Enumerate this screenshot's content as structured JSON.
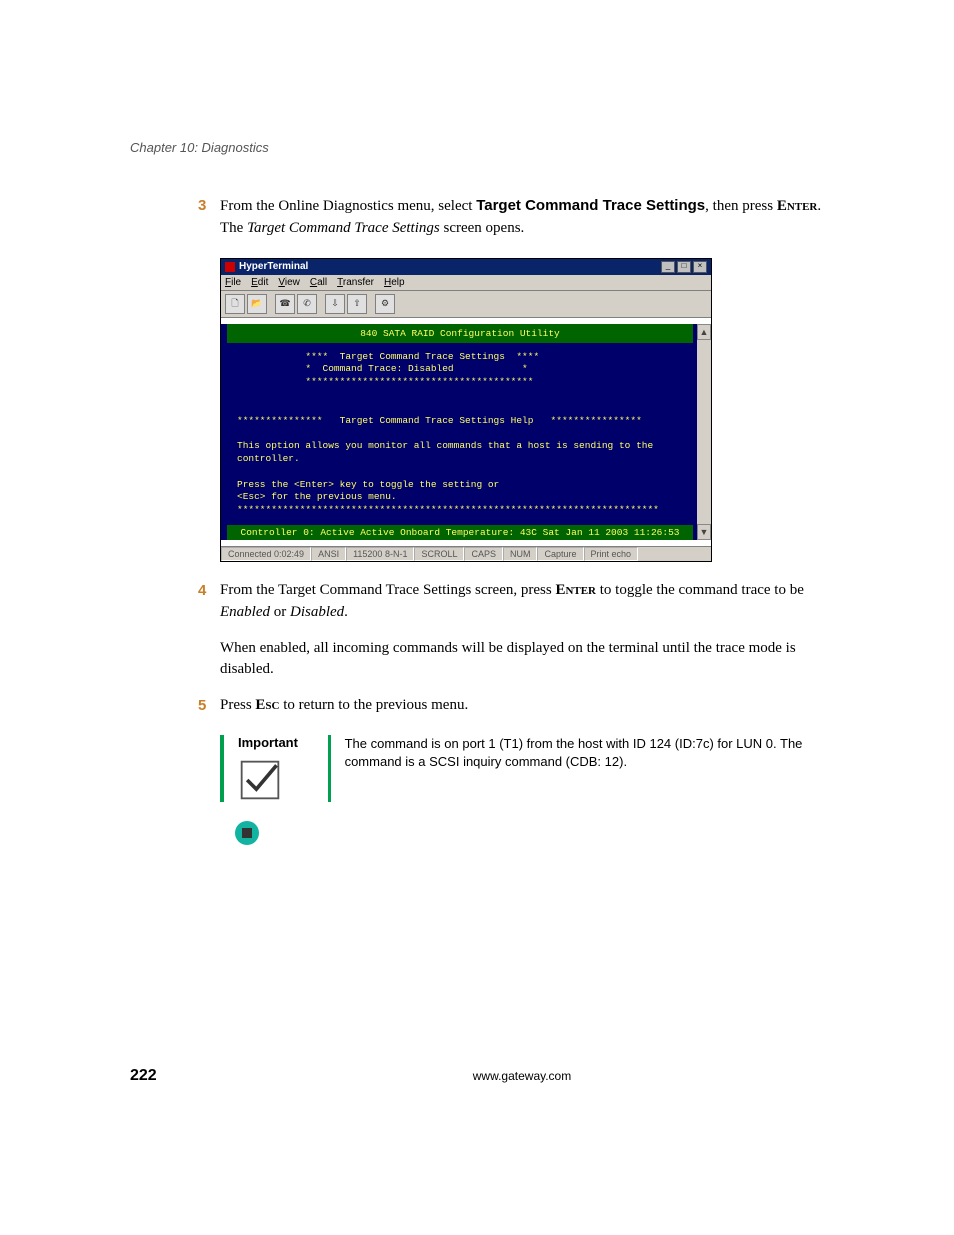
{
  "chapter_header": "Chapter 10: Diagnostics",
  "steps": {
    "s3": {
      "num": "3",
      "pre": "From the Online Diagnostics menu, select ",
      "bold": "Target Command Trace Settings",
      "mid": ", then press ",
      "key": "Enter",
      "post1": ". The ",
      "ital": "Target Command Trace Settings",
      "post2": " screen opens."
    },
    "s4": {
      "num": "4",
      "pre": "From the Target Command Trace Settings screen, press ",
      "key": "Enter",
      "post1": " to toggle the command trace to be ",
      "ital1": "Enabled",
      "or": " or ",
      "ital2": "Disabled",
      "post2": "."
    },
    "s4b": "When enabled, all incoming commands will be displayed on the terminal until the trace mode is disabled.",
    "s5": {
      "num": "5",
      "pre": "Press ",
      "key": "Esc",
      "post": " to return to the previous menu."
    }
  },
  "screenshot": {
    "title": "HyperTerminal",
    "menus": [
      "File",
      "Edit",
      "View",
      "Call",
      "Transfer",
      "Help"
    ],
    "toolbar": [
      "new-doc-icon",
      "open-icon",
      "connect-icon",
      "disconnect-icon",
      "send-icon",
      "receive-icon",
      "properties-icon"
    ],
    "term_title": "840 SATA RAID Configuration Utility",
    "term_body": "            ****  Target Command Trace Settings  ****\n            *  Command Trace: Disabled            *\n            ****************************************\n\n\n***************   Target Command Trace Settings Help   ****************\n\nThis option allows you monitor all commands that a host is sending to the\ncontroller.\n\nPress the <Enter> key to toggle the setting or\n<Esc> for the previous menu.\n**************************************************************************",
    "term_status": "Controller 0:  Active Active   Onboard Temperature: 43C   Sat Jan 11 2003  11:26:53",
    "status_cells": [
      "Connected 0:02:49",
      "ANSI",
      "115200 8-N-1",
      "SCROLL",
      "CAPS",
      "NUM",
      "Capture",
      "Print echo"
    ]
  },
  "important": {
    "label": "Important",
    "text": "The command is on port 1 (T1) from the host with ID 124 (ID:7c) for LUN 0. The command is a SCSI inquiry command (CDB: 12)."
  },
  "footer": {
    "page": "222",
    "url": "www.gateway.com"
  }
}
